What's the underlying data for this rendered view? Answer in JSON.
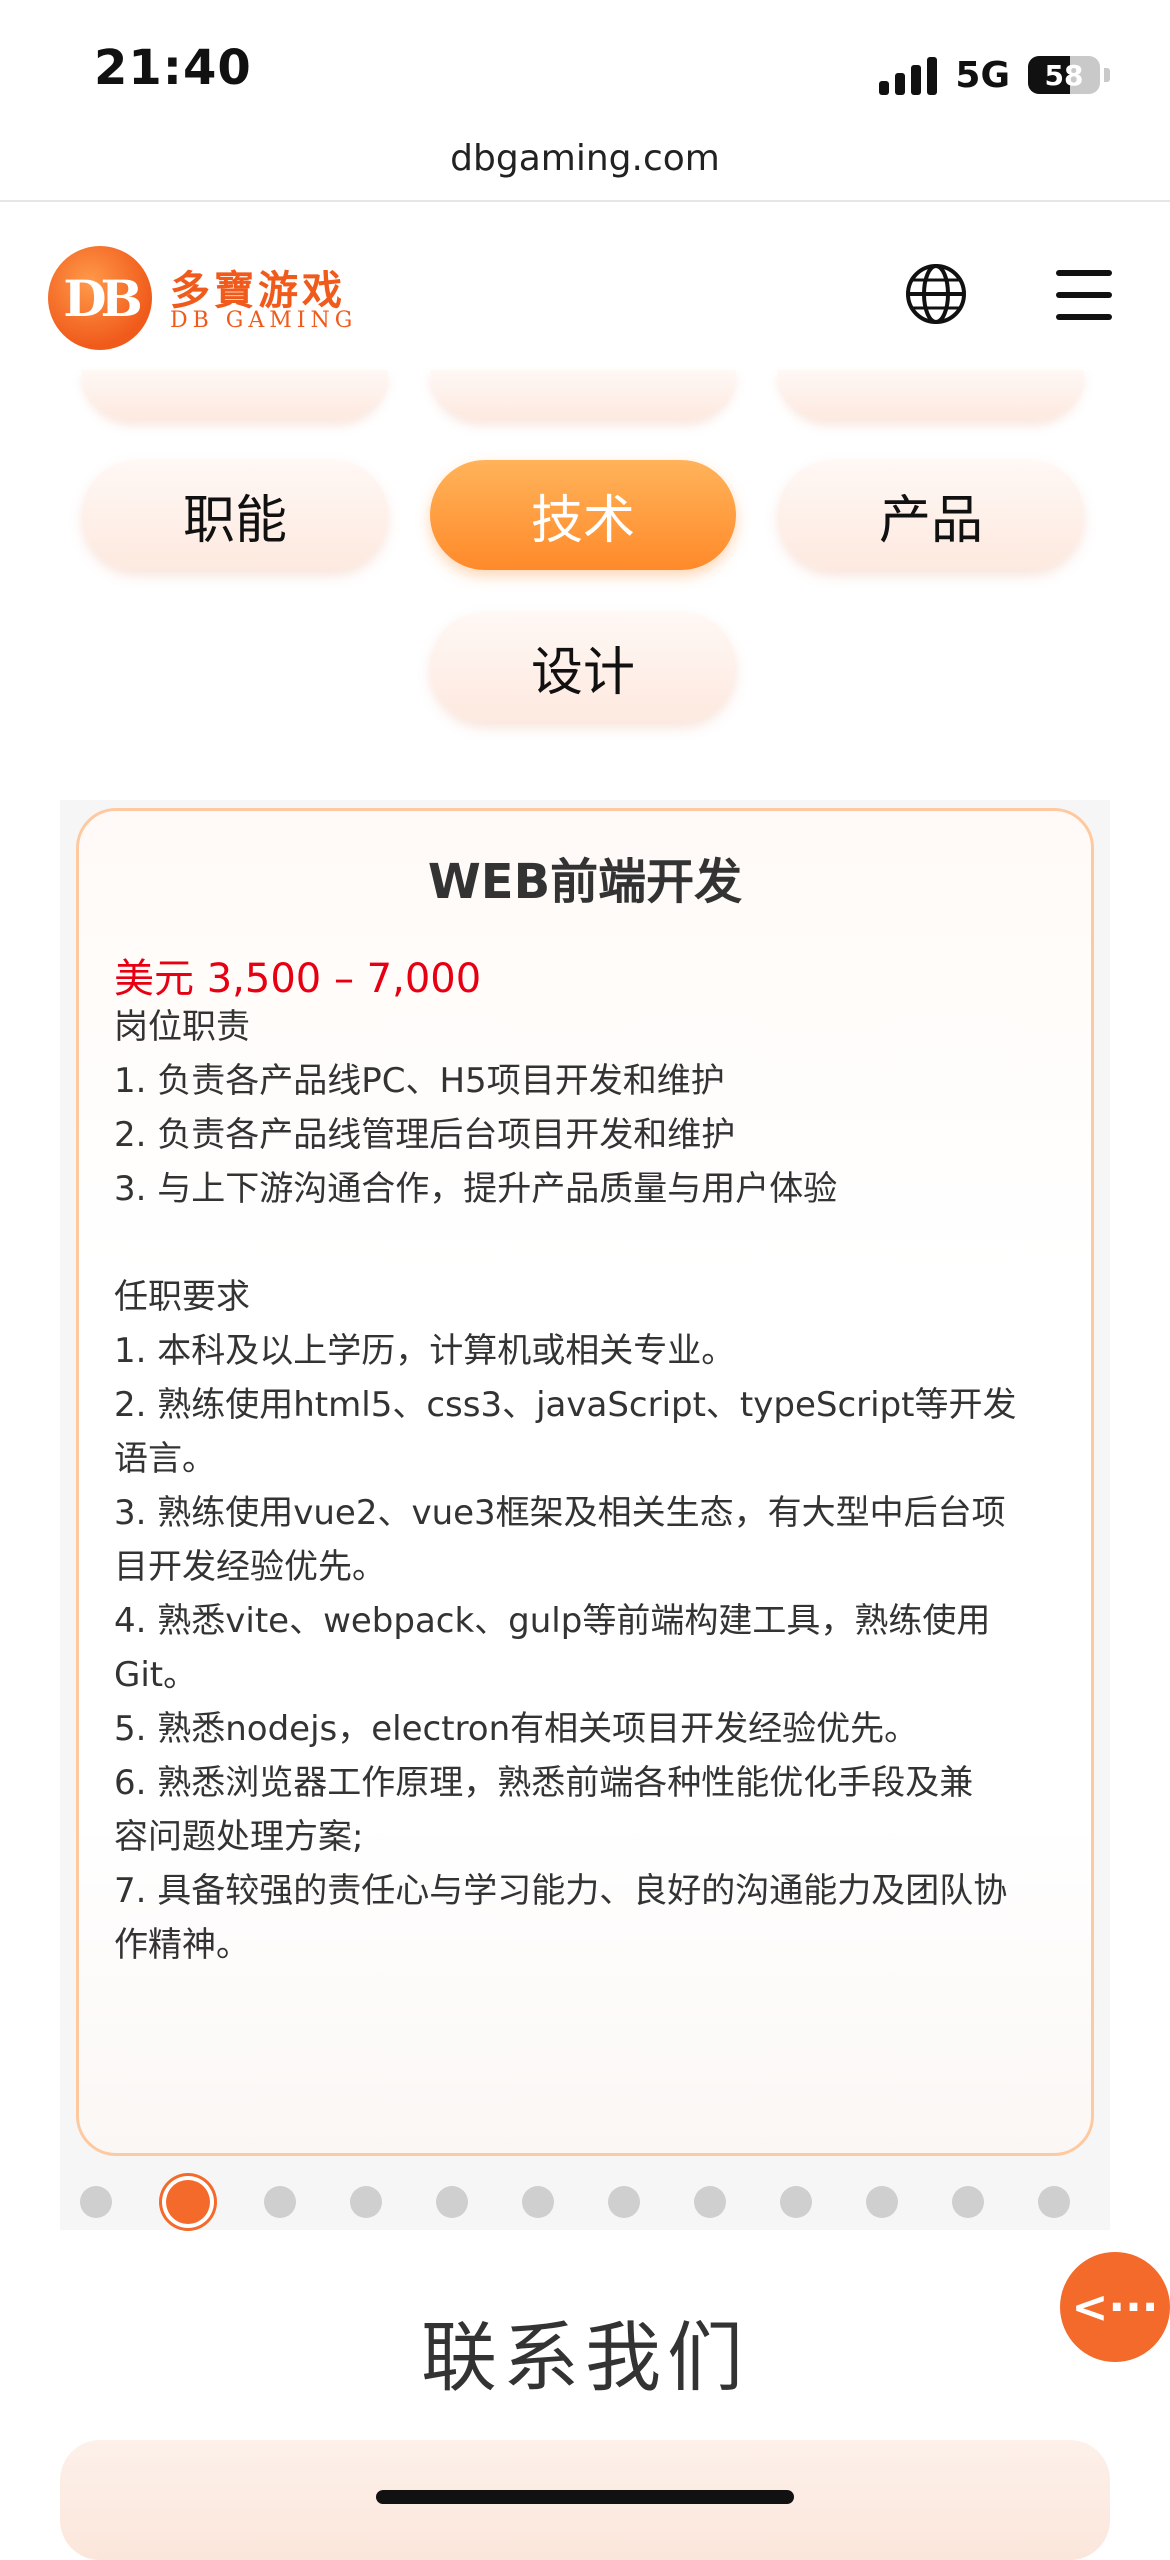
{
  "status_bar": {
    "time": "21:40",
    "network": "5G",
    "battery": "58"
  },
  "browser": {
    "url": "dbgaming.com"
  },
  "header": {
    "logo_mark": "DB",
    "logo_cn": "多寶游戏",
    "logo_en": "DB GAMING",
    "icons": [
      "globe-icon",
      "hamburger-menu-icon"
    ]
  },
  "categories": {
    "items": [
      {
        "label": "职能",
        "active": false
      },
      {
        "label": "技术",
        "active": true
      },
      {
        "label": "产品",
        "active": false
      },
      {
        "label": "设计",
        "active": false
      }
    ]
  },
  "job": {
    "title": "WEB前端开发",
    "salary": "美元 3,500 – 7,000",
    "description": [
      "岗位职责",
      "1. 负责各产品线PC、H5项目开发和维护",
      "2. 负责各产品线管理后台项目开发和维护",
      "3. 与上下游沟通合作，提升产品质量与用户体验",
      "",
      "任职要求",
      "1. 本科及以上学历，计算机或相关专业。",
      "2. 熟练使用html5、css3、javaScript、typeScript等开发",
      "语言。",
      "3. 熟练使用vue2、vue3框架及相关生态，有大型中后台项",
      "目开发经验优先。",
      "4. 熟悉vite、webpack、gulp等前端构建工具，熟练使用",
      "Git。",
      "5. 熟悉nodejs，electron有相关项目开发经验优先。",
      "6. 熟悉浏览器工作原理，熟悉前端各种性能优化手段及兼",
      "容问题处理方案;",
      "7. 具备较强的责任心与学习能力、良好的沟通能力及团队协",
      "作精神。"
    ]
  },
  "pagination": {
    "total": 12,
    "current_index": 1
  },
  "fab": {
    "icon": "back-arrow-icon",
    "label": "<···"
  },
  "contact": {
    "title": "联系我们"
  },
  "colors": {
    "brand_orange": "#f36a2a",
    "salary_red": "#e60012",
    "card_border": "#ffc9a0"
  }
}
